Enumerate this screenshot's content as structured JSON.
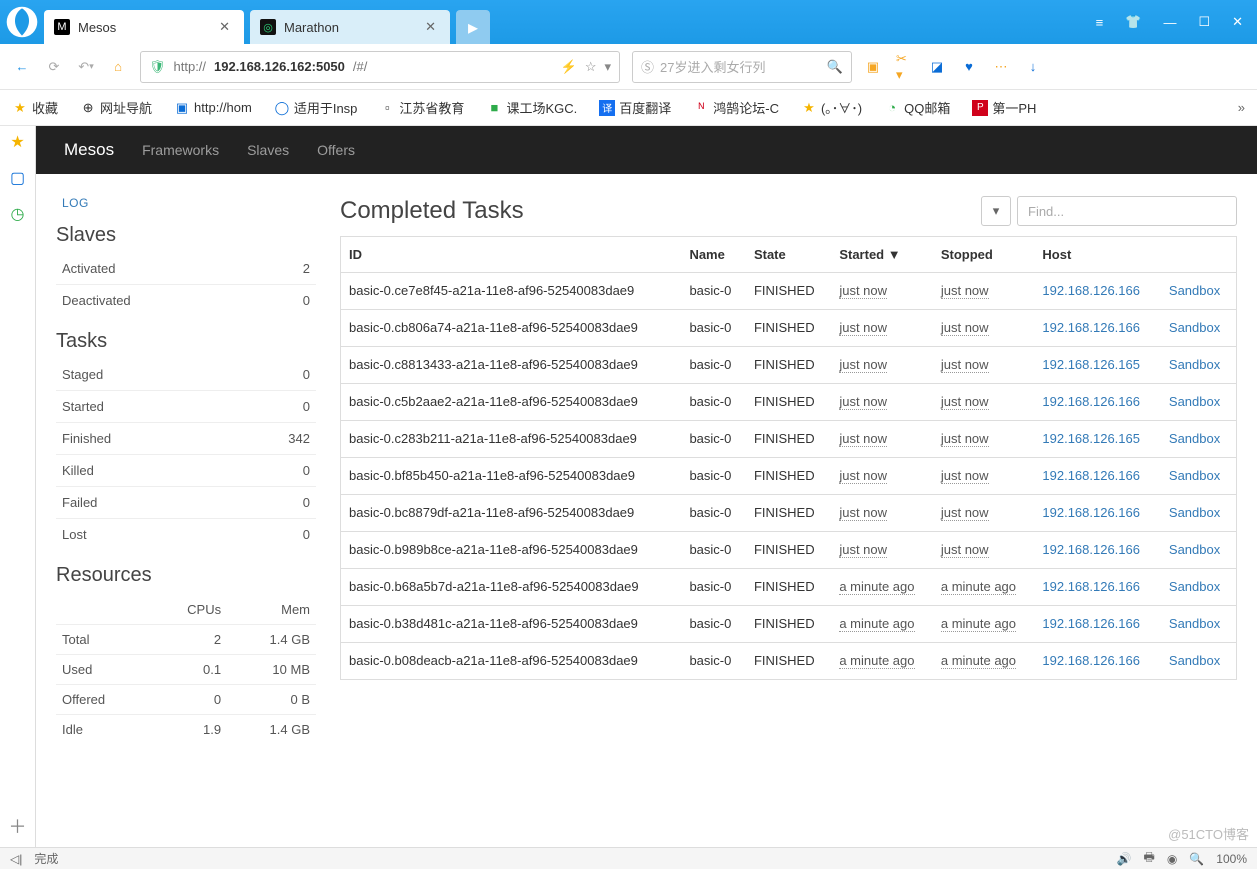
{
  "browser": {
    "tabs": [
      {
        "title": "Mesos",
        "active": true,
        "icon": "M"
      },
      {
        "title": "Marathon",
        "active": false,
        "icon": "◎"
      }
    ],
    "url": {
      "prefix": "http://",
      "host": "192.168.126.162:5050",
      "path": "/#/"
    },
    "search_placeholder": "27岁进入剩女行列",
    "bookmarks_label": "收藏",
    "bookmarks": [
      {
        "label": "网址导航",
        "icon": "⊕"
      },
      {
        "label": "http://hom",
        "icon": "▣",
        "color": "#0a6cd6"
      },
      {
        "label": "适用于Insp",
        "icon": "◯",
        "color": "#0a6cd6"
      },
      {
        "label": "江苏省教育",
        "icon": "▫"
      },
      {
        "label": "课工场KGC.",
        "icon": "■",
        "color": "#2eab4a"
      },
      {
        "label": "百度翻译",
        "icon": "译",
        "color": "#0a6cd6"
      },
      {
        "label": "鸿鹄论坛-C",
        "icon": "N",
        "color": "#d0021b"
      },
      {
        "label": "(｡･∀･)",
        "icon": "★",
        "color": "#f5b400"
      },
      {
        "label": "QQ邮箱",
        "icon": "◔",
        "color": "#2eab4a"
      },
      {
        "label": "第一PH",
        "icon": "P",
        "color": "#d0021b"
      }
    ]
  },
  "mesos_nav": {
    "brand": "Mesos",
    "links": [
      "Frameworks",
      "Slaves",
      "Offers"
    ]
  },
  "sidebar": {
    "log_label": "LOG",
    "slaves_title": "Slaves",
    "slaves": [
      {
        "k": "Activated",
        "v": "2"
      },
      {
        "k": "Deactivated",
        "v": "0"
      }
    ],
    "tasks_title": "Tasks",
    "tasks": [
      {
        "k": "Staged",
        "v": "0"
      },
      {
        "k": "Started",
        "v": "0"
      },
      {
        "k": "Finished",
        "v": "342"
      },
      {
        "k": "Killed",
        "v": "0"
      },
      {
        "k": "Failed",
        "v": "0"
      },
      {
        "k": "Lost",
        "v": "0"
      }
    ],
    "resources_title": "Resources",
    "res_head": [
      "",
      "CPUs",
      "Mem"
    ],
    "res_rows": [
      {
        "k": "Total",
        "cpu": "2",
        "mem": "1.4 GB"
      },
      {
        "k": "Used",
        "cpu": "0.1",
        "mem": "10 MB"
      },
      {
        "k": "Offered",
        "cpu": "0",
        "mem": "0 B"
      },
      {
        "k": "Idle",
        "cpu": "1.9",
        "mem": "1.4 GB"
      }
    ]
  },
  "main": {
    "title": "Completed Tasks",
    "find_placeholder": "Find...",
    "columns": [
      "ID",
      "Name",
      "State",
      "Started ▼",
      "Stopped",
      "Host",
      ""
    ],
    "rows": [
      {
        "id": "basic-0.ce7e8f45-a21a-11e8-af96-52540083dae9",
        "name": "basic-0",
        "state": "FINISHED",
        "started": "just now",
        "stopped": "just now",
        "host": "192.168.126.166",
        "sb": "Sandbox"
      },
      {
        "id": "basic-0.cb806a74-a21a-11e8-af96-52540083dae9",
        "name": "basic-0",
        "state": "FINISHED",
        "started": "just now",
        "stopped": "just now",
        "host": "192.168.126.166",
        "sb": "Sandbox"
      },
      {
        "id": "basic-0.c8813433-a21a-11e8-af96-52540083dae9",
        "name": "basic-0",
        "state": "FINISHED",
        "started": "just now",
        "stopped": "just now",
        "host": "192.168.126.165",
        "sb": "Sandbox"
      },
      {
        "id": "basic-0.c5b2aae2-a21a-11e8-af96-52540083dae9",
        "name": "basic-0",
        "state": "FINISHED",
        "started": "just now",
        "stopped": "just now",
        "host": "192.168.126.166",
        "sb": "Sandbox"
      },
      {
        "id": "basic-0.c283b211-a21a-11e8-af96-52540083dae9",
        "name": "basic-0",
        "state": "FINISHED",
        "started": "just now",
        "stopped": "just now",
        "host": "192.168.126.165",
        "sb": "Sandbox"
      },
      {
        "id": "basic-0.bf85b450-a21a-11e8-af96-52540083dae9",
        "name": "basic-0",
        "state": "FINISHED",
        "started": "just now",
        "stopped": "just now",
        "host": "192.168.126.166",
        "sb": "Sandbox"
      },
      {
        "id": "basic-0.bc8879df-a21a-11e8-af96-52540083dae9",
        "name": "basic-0",
        "state": "FINISHED",
        "started": "just now",
        "stopped": "just now",
        "host": "192.168.126.166",
        "sb": "Sandbox"
      },
      {
        "id": "basic-0.b989b8ce-a21a-11e8-af96-52540083dae9",
        "name": "basic-0",
        "state": "FINISHED",
        "started": "just now",
        "stopped": "just now",
        "host": "192.168.126.166",
        "sb": "Sandbox"
      },
      {
        "id": "basic-0.b68a5b7d-a21a-11e8-af96-52540083dae9",
        "name": "basic-0",
        "state": "FINISHED",
        "started": "a minute ago",
        "stopped": "a minute ago",
        "host": "192.168.126.166",
        "sb": "Sandbox"
      },
      {
        "id": "basic-0.b38d481c-a21a-11e8-af96-52540083dae9",
        "name": "basic-0",
        "state": "FINISHED",
        "started": "a minute ago",
        "stopped": "a minute ago",
        "host": "192.168.126.166",
        "sb": "Sandbox"
      },
      {
        "id": "basic-0.b08deacb-a21a-11e8-af96-52540083dae9",
        "name": "basic-0",
        "state": "FINISHED",
        "started": "a minute ago",
        "stopped": "a minute ago",
        "host": "192.168.126.166",
        "sb": "Sandbox"
      }
    ]
  },
  "status": {
    "left": "完成",
    "watermark": "@51CTO博客",
    "zoom": "100%"
  }
}
